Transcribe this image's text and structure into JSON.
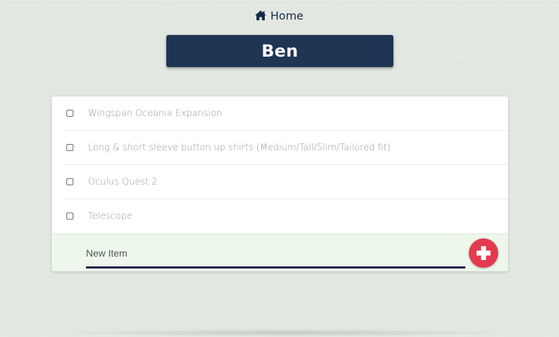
{
  "nav": {
    "home_label": "Home",
    "home_icon": "home-icon"
  },
  "list": {
    "title": "Ben",
    "items": [
      {
        "label": "Wingspan Oceania Expansion",
        "checked": false
      },
      {
        "label": "Long & short sleeve button up shirts (Medium/Tall/Slim/Tailored fit)",
        "checked": false
      },
      {
        "label": "Oculus Quest 2",
        "checked": false
      },
      {
        "label": "Telescope",
        "checked": false
      }
    ]
  },
  "new_item": {
    "placeholder": "New Item",
    "value": "",
    "add_icon": "plus-icon"
  },
  "colors": {
    "background": "#e3e7e1",
    "title_bg": "#1f3554",
    "accent_red": "#e33a4f",
    "input_underline": "#17234a",
    "new_item_bg": "#eef7ec"
  }
}
